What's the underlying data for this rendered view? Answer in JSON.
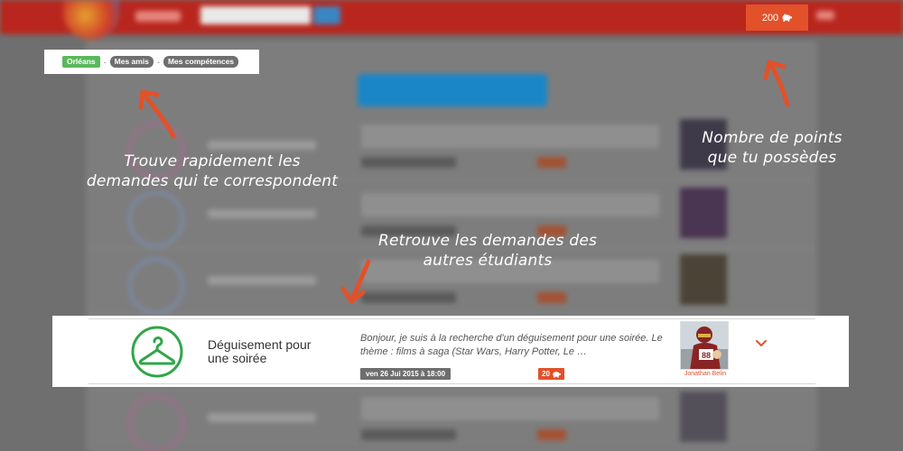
{
  "filters": {
    "city": "Orléans",
    "separator": "-",
    "friends": "Mes amis",
    "skills": "Mes compétences"
  },
  "header": {
    "points": "200",
    "points_icon": "piggy-bank-icon"
  },
  "callouts": {
    "filters": [
      "Trouve rapidement les",
      "demandes qui te correspondent"
    ],
    "points": [
      "Nombre de points",
      "que tu possèdes"
    ],
    "requests": [
      "Retrouve les demandes des",
      "autres étudiants"
    ]
  },
  "request": {
    "category_icon": "hanger-icon",
    "title": "Déguisement pour une soirée",
    "description": "Bonjour, je suis à la recherche d'un déguisement pour une soirée. Le thème : films à saga (Star Wars, Harry Potter, Le …",
    "date": "ven 26 Jui 2015 à 18:00",
    "points": "20",
    "user": "Jonathan Belin",
    "expand_icon": "chevron-down-icon"
  },
  "colors": {
    "header": "#b8261d",
    "accent": "#e2512a",
    "category_green": "#2fa64a",
    "city_tag": "#5bb85c"
  }
}
